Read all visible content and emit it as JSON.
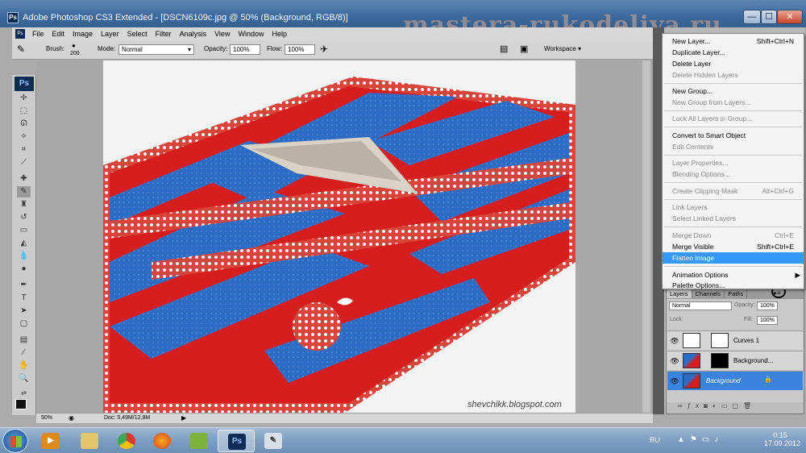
{
  "window": {
    "title": "Adobe Photoshop CS3 Extended - [DSCN6109c.jpg @ 50% (Background, RGB/8)]",
    "app_icon": "Ps",
    "minimize": "—",
    "maximize": "☐",
    "close": "✕"
  },
  "watermark": "mastera-rukodeliya.ru",
  "menu": [
    "File",
    "Edit",
    "Image",
    "Layer",
    "Select",
    "Filter",
    "Analysis",
    "View",
    "Window",
    "Help"
  ],
  "options": {
    "brush_label": "Brush:",
    "brush_size": "200",
    "mode_label": "Mode:",
    "mode_value": "Normal",
    "opacity_label": "Opacity:",
    "opacity_value": "100%",
    "flow_label": "Flow:",
    "flow_value": "100%",
    "workspace": "Workspace"
  },
  "canvas": {
    "credit": "shevchikk.blogspot.com"
  },
  "status": {
    "zoom": "50%",
    "doc": "Doc: 5,49M/12,8M"
  },
  "flyout_menu": [
    {
      "label": "New Layer...",
      "shortcut": "Shift+Ctrl+N",
      "disabled": false,
      "highlight": false
    },
    {
      "label": "Duplicate Layer...",
      "shortcut": "",
      "disabled": false,
      "highlight": false
    },
    {
      "label": "Delete Layer",
      "shortcut": "",
      "disabled": false,
      "highlight": false
    },
    {
      "label": "Delete Hidden Layers",
      "shortcut": "",
      "disabled": true,
      "highlight": false
    },
    {
      "label": "New Group...",
      "shortcut": "",
      "disabled": false,
      "highlight": false
    },
    {
      "label": "New Group from Layers...",
      "shortcut": "",
      "disabled": true,
      "highlight": false
    },
    {
      "label": "Lock All Layers in Group...",
      "shortcut": "",
      "disabled": true,
      "highlight": false
    },
    {
      "label": "Convert to Smart Object",
      "shortcut": "",
      "disabled": false,
      "highlight": false
    },
    {
      "label": "Edit Contents",
      "shortcut": "",
      "disabled": true,
      "highlight": false
    },
    {
      "label": "Layer Properties...",
      "shortcut": "",
      "disabled": true,
      "highlight": false
    },
    {
      "label": "Blending Options...",
      "shortcut": "",
      "disabled": true,
      "highlight": false
    },
    {
      "label": "Create Clipping Mask",
      "shortcut": "Alt+Ctrl+G",
      "disabled": true,
      "highlight": false
    },
    {
      "label": "Link Layers",
      "shortcut": "",
      "disabled": true,
      "highlight": false
    },
    {
      "label": "Select Linked Layers",
      "shortcut": "",
      "disabled": true,
      "highlight": false
    },
    {
      "label": "Merge Down",
      "shortcut": "Ctrl+E",
      "disabled": true,
      "highlight": false
    },
    {
      "label": "Merge Visible",
      "shortcut": "Shift+Ctrl+E",
      "disabled": false,
      "highlight": false
    },
    {
      "label": "Flatten Image",
      "shortcut": "",
      "disabled": false,
      "highlight": true
    },
    {
      "label": "Animation Options",
      "shortcut": "",
      "disabled": false,
      "highlight": false
    },
    {
      "label": "Palette Options...",
      "shortcut": "",
      "disabled": false,
      "highlight": false
    }
  ],
  "layers_panel": {
    "tabs": [
      "Layers",
      "Channels",
      "Paths"
    ],
    "blend_mode": "Normal",
    "opacity_label": "Opacity:",
    "opacity_value": "100%",
    "lock_label": "Lock:",
    "fill_label": "Fill:",
    "fill_value": "100%",
    "layers": [
      {
        "name": "Curves 1",
        "selected": false
      },
      {
        "name": "Background...",
        "selected": false
      },
      {
        "name": "Background",
        "selected": true
      }
    ]
  },
  "taskbar": {
    "language": "RU",
    "time": "0:15",
    "date": "17.09.2012"
  }
}
